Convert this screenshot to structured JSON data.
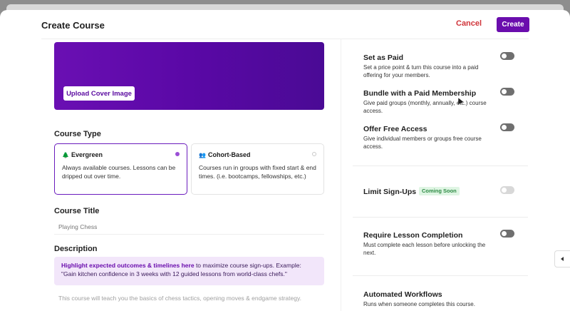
{
  "header": {
    "title": "Create Course",
    "cancel_label": "Cancel",
    "create_label": "Create"
  },
  "cover": {
    "upload_label": "Upload Cover Image"
  },
  "course_type": {
    "label": "Course Type",
    "options": [
      {
        "icon": "🌲",
        "title": "Evergreen",
        "desc": "Always available courses. Lessons can be dripped out over time.",
        "selected": true
      },
      {
        "icon": "👥",
        "title": "Cohort-Based",
        "desc": "Courses run in groups with fixed start & end times. (i.e. bootcamps, fellowships, etc.)",
        "selected": false
      }
    ]
  },
  "course_title": {
    "label": "Course Title",
    "placeholder": "Playing Chess"
  },
  "description": {
    "label": "Description",
    "hint_bold": "Highlight expected outcomes & timelines here",
    "hint_rest": " to maximize course sign-ups. Example: \"Gain kitchen confidence in 3 weeks with 12 guided lessons from world-class chefs.\"",
    "text": "This course will teach you the basics of chess tactics, opening moves & endgame strategy."
  },
  "settings": [
    {
      "title": "Set as Paid",
      "desc": "Set a price point & turn this course into a paid offering for your members."
    },
    {
      "title": "Bundle with a Paid Membership",
      "desc": "Give paid groups (monthly, annually, etc.) course access."
    },
    {
      "title": "Offer Free Access",
      "desc": "Give individual members or groups free course access."
    },
    {
      "title": "Limit Sign-Ups",
      "badge": "Coming Soon"
    },
    {
      "title": "Require Lesson Completion",
      "desc": "Must complete each lesson before unlocking the next."
    },
    {
      "title": "Automated Workflows",
      "desc": "Runs when someone completes this course."
    }
  ],
  "colors": {
    "accent": "#6a0dad",
    "cancel": "#d0343a",
    "badge_bg": "#dff5e3",
    "badge_text": "#2e8b45"
  }
}
